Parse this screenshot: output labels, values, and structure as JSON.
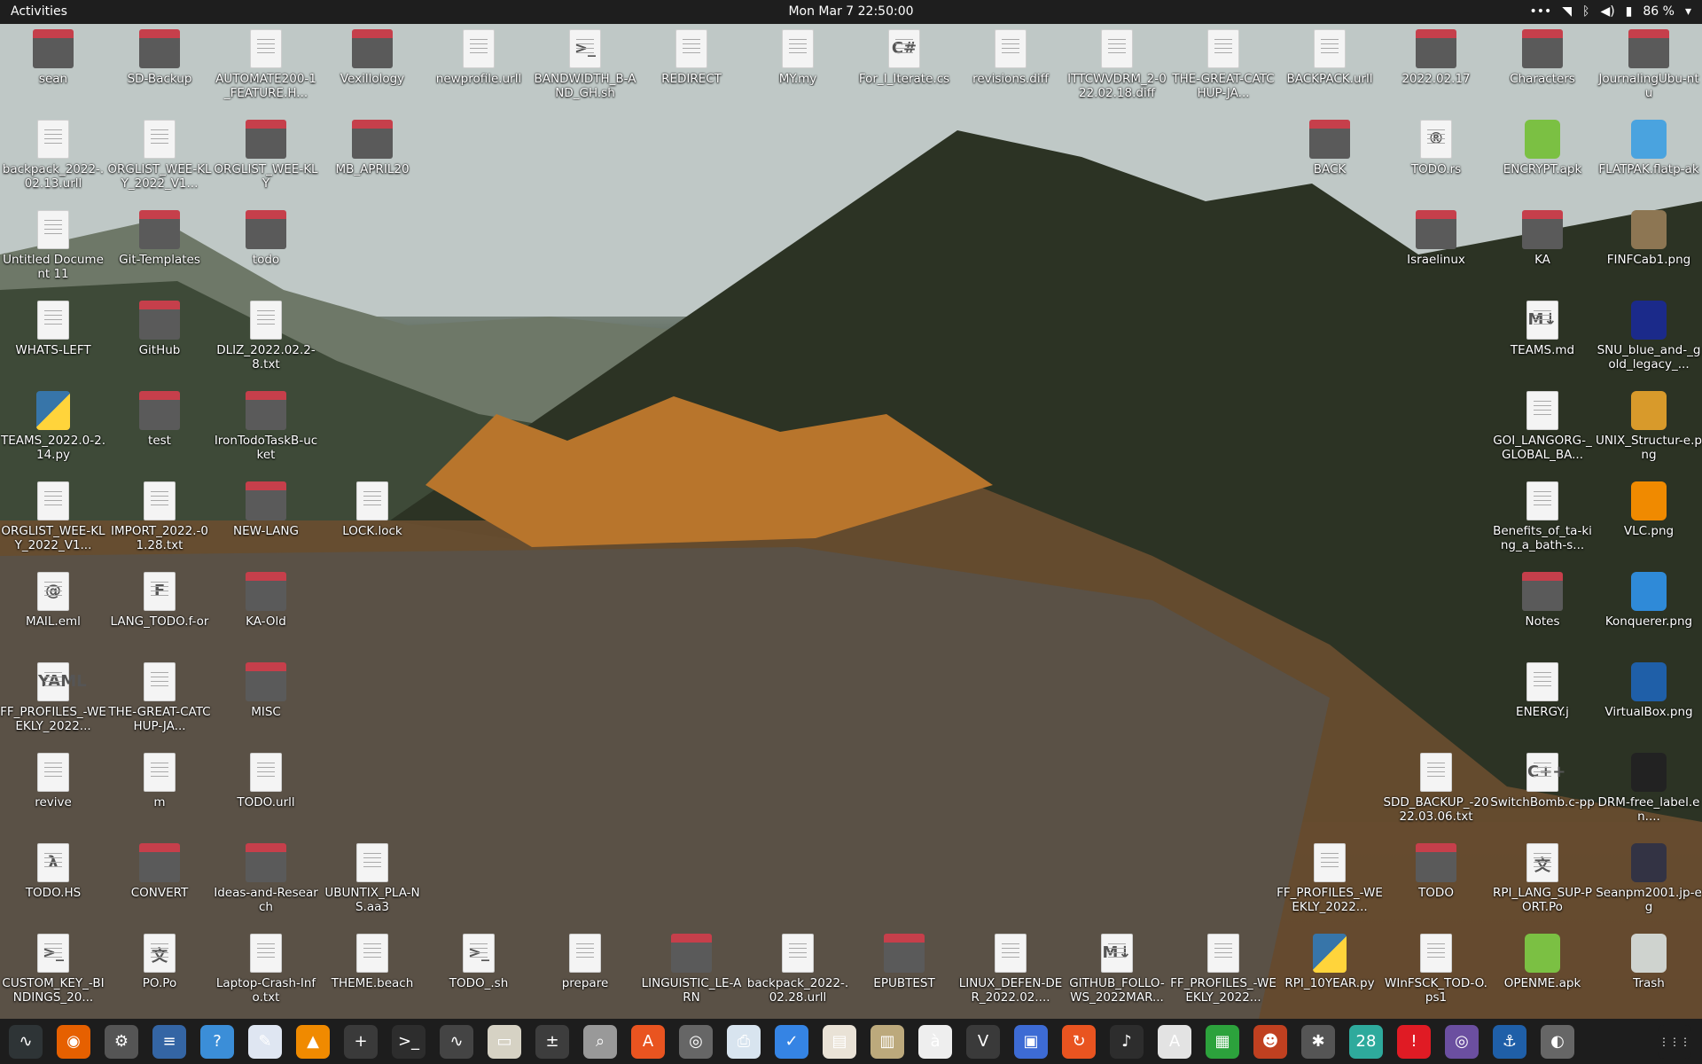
{
  "topbar": {
    "activities": "Activities",
    "clock": "Mon Mar 7  22:50:00",
    "battery": "86 %",
    "icons": [
      "dots-icon",
      "wifi-icon",
      "bluetooth-icon",
      "volume-icon",
      "battery-icon"
    ]
  },
  "desktop_icons": [
    {
      "label": "sean",
      "kind": "folder",
      "col": 0,
      "row": 0
    },
    {
      "label": "SD-Backup",
      "kind": "folder",
      "col": 1,
      "row": 0
    },
    {
      "label": "AUTOMATE200-1_FEATURE.H...",
      "kind": "doc",
      "col": 2,
      "row": 0
    },
    {
      "label": "Vexillology",
      "kind": "folder",
      "col": 3,
      "row": 0
    },
    {
      "label": "newprofile.urll",
      "kind": "doc",
      "col": 4,
      "row": 0
    },
    {
      "label": "BANDWIDTH_B-AND_GH.sh",
      "kind": "doc",
      "sym": ">_",
      "col": 5,
      "row": 0
    },
    {
      "label": "REDIRECT",
      "kind": "doc",
      "col": 6,
      "row": 0
    },
    {
      "label": "MY.my",
      "kind": "doc",
      "col": 7,
      "row": 0
    },
    {
      "label": "For_I_Iterate.cs",
      "kind": "doc",
      "sym": "C#",
      "col": 8,
      "row": 0
    },
    {
      "label": "revisions.diff",
      "kind": "doc",
      "col": 9,
      "row": 0
    },
    {
      "label": "ITTCWVDRM_2-022.02.18.diff",
      "kind": "doc",
      "col": 10,
      "row": 0
    },
    {
      "label": "THE-GREAT-CATCHUP-JA...",
      "kind": "doc",
      "col": 11,
      "row": 0
    },
    {
      "label": "BACKPACK.urll",
      "kind": "doc",
      "col": 12,
      "row": 0
    },
    {
      "label": "2022.02.17",
      "kind": "folder",
      "col": 13,
      "row": 0
    },
    {
      "label": "Characters",
      "kind": "folder",
      "col": 14,
      "row": 0
    },
    {
      "label": "JournalingUbu-ntu",
      "kind": "folder",
      "col": 15,
      "row": 0
    },
    {
      "label": "backpack_2022-.02.13.urll",
      "kind": "doc",
      "col": 0,
      "row": 1
    },
    {
      "label": "ORGLIST_WEE-KLY_2022_V1...",
      "kind": "doc",
      "col": 1,
      "row": 1
    },
    {
      "label": "ORGLIST_WEE-KLY",
      "kind": "folder",
      "col": 2,
      "row": 1
    },
    {
      "label": "MB_APRIL20",
      "kind": "folder",
      "col": 3,
      "row": 1
    },
    {
      "label": "BACK",
      "kind": "folder",
      "col": 12,
      "row": 1
    },
    {
      "label": "TODO.rs",
      "kind": "doc",
      "sym": "®",
      "col": 13,
      "row": 1
    },
    {
      "label": "ENCRYPT.apk",
      "kind": "app",
      "color": "#7bc043",
      "col": 14,
      "row": 1
    },
    {
      "label": "FLATPAK.flatp-ak",
      "kind": "app",
      "color": "#4aa3df",
      "col": 15,
      "row": 1
    },
    {
      "label": "Untitled Document 11",
      "kind": "doc",
      "col": 0,
      "row": 2
    },
    {
      "label": "Git-Templates",
      "kind": "folder",
      "col": 1,
      "row": 2
    },
    {
      "label": "todo",
      "kind": "folder",
      "col": 2,
      "row": 2
    },
    {
      "label": "Israelinux",
      "kind": "folder",
      "col": 13,
      "row": 2
    },
    {
      "label": "KA",
      "kind": "folder",
      "col": 14,
      "row": 2
    },
    {
      "label": "FINFCab1.png",
      "kind": "app",
      "color": "#8d7653",
      "col": 15,
      "row": 2
    },
    {
      "label": "WHATS-LEFT",
      "kind": "doc",
      "col": 0,
      "row": 3
    },
    {
      "label": "GitHub",
      "kind": "folder",
      "col": 1,
      "row": 3
    },
    {
      "label": "DLIZ_2022.02.2-8.txt",
      "kind": "doc",
      "col": 2,
      "row": 3
    },
    {
      "label": "TEAMS.md",
      "kind": "doc",
      "sym": "M↓",
      "col": 14,
      "row": 3
    },
    {
      "label": "SNU_blue_and-_gold_legacy_...",
      "kind": "app",
      "color": "#1b2a8a",
      "col": 15,
      "row": 3
    },
    {
      "label": "TEAMS_2022.0-2.14.py",
      "kind": "py",
      "col": 0,
      "row": 4
    },
    {
      "label": "test",
      "kind": "folder",
      "col": 1,
      "row": 4
    },
    {
      "label": "IronTodoTaskB-ucket",
      "kind": "folder",
      "col": 2,
      "row": 4
    },
    {
      "label": "GOI_LANGORG-_GLOBAL_BA...",
      "kind": "doc",
      "col": 14,
      "row": 4
    },
    {
      "label": "UNIX_Structur-e.png",
      "kind": "app",
      "color": "#d89a2b",
      "col": 15,
      "row": 4
    },
    {
      "label": "ORGLIST_WEE-KLY_2022_V1...",
      "kind": "doc",
      "col": 0,
      "row": 5
    },
    {
      "label": "IMPORT_2022.-01.28.txt",
      "kind": "doc",
      "col": 1,
      "row": 5
    },
    {
      "label": "NEW-LANG",
      "kind": "folder",
      "col": 2,
      "row": 5
    },
    {
      "label": "LOCK.lock",
      "kind": "doc",
      "col": 3,
      "row": 5
    },
    {
      "label": "Benefits_of_ta-king_a_bath-s...",
      "kind": "doc",
      "col": 14,
      "row": 5
    },
    {
      "label": "VLC.png",
      "kind": "app",
      "color": "#f08a00",
      "col": 15,
      "row": 5
    },
    {
      "label": "MAIL.eml",
      "kind": "doc",
      "sym": "@",
      "col": 0,
      "row": 6
    },
    {
      "label": "LANG_TODO.f-or",
      "kind": "doc",
      "sym": "F",
      "col": 1,
      "row": 6
    },
    {
      "label": "KA-Old",
      "kind": "folder",
      "col": 2,
      "row": 6
    },
    {
      "label": "Notes",
      "kind": "folder",
      "col": 14,
      "row": 6
    },
    {
      "label": "Konquerer.png",
      "kind": "app",
      "color": "#2f8ad8",
      "col": 15,
      "row": 6
    },
    {
      "label": "FF_PROFILES_-WEEKLY_2022...",
      "kind": "doc",
      "sym": "YAML",
      "col": 0,
      "row": 7
    },
    {
      "label": "THE-GREAT-CATCHUP-JA...",
      "kind": "doc",
      "col": 1,
      "row": 7
    },
    {
      "label": "MISC",
      "kind": "folder",
      "col": 2,
      "row": 7
    },
    {
      "label": "ENERGY.j",
      "kind": "doc",
      "col": 14,
      "row": 7
    },
    {
      "label": "VirtualBox.png",
      "kind": "app",
      "color": "#1f5fa8",
      "col": 15,
      "row": 7
    },
    {
      "label": "revive",
      "kind": "doc",
      "col": 0,
      "row": 8
    },
    {
      "label": "m",
      "kind": "doc",
      "col": 1,
      "row": 8
    },
    {
      "label": "TODO.urll",
      "kind": "doc",
      "col": 2,
      "row": 8
    },
    {
      "label": "SDD_BACKUP_-2022.03.06.txt",
      "kind": "doc",
      "col": 13,
      "row": 8
    },
    {
      "label": "SwitchBomb.c-pp",
      "kind": "doc",
      "sym": "C++",
      "col": 14,
      "row": 8
    },
    {
      "label": "DRM-free_label.en....",
      "kind": "app",
      "color": "#222",
      "col": 15,
      "row": 8
    },
    {
      "label": "TODO.HS",
      "kind": "doc",
      "sym": "λ",
      "col": 0,
      "row": 9
    },
    {
      "label": "CONVERT",
      "kind": "folder",
      "col": 1,
      "row": 9
    },
    {
      "label": "Ideas-and-Research",
      "kind": "folder",
      "col": 2,
      "row": 9
    },
    {
      "label": "UBUNTIX_PLA-NS.aa3",
      "kind": "doc",
      "col": 3,
      "row": 9
    },
    {
      "label": "FF_PROFILES_-WEEKLY_2022...",
      "kind": "doc",
      "col": 12,
      "row": 9
    },
    {
      "label": "TODO",
      "kind": "folder",
      "col": 13,
      "row": 9
    },
    {
      "label": "RPI_LANG_SUP-PORT.Po",
      "kind": "doc",
      "sym": "文",
      "col": 14,
      "row": 9
    },
    {
      "label": "Seanpm2001.jp-eg",
      "kind": "app",
      "color": "#334",
      "col": 15,
      "row": 9
    },
    {
      "label": "CUSTOM_KEY_-BINDINGS_20...",
      "kind": "doc",
      "sym": ">_",
      "col": 0,
      "row": 10
    },
    {
      "label": "PO.Po",
      "kind": "doc",
      "sym": "文",
      "col": 1,
      "row": 10
    },
    {
      "label": "Laptop-Crash-Info.txt",
      "kind": "doc",
      "col": 2,
      "row": 10
    },
    {
      "label": "THEME.beach",
      "kind": "doc",
      "col": 3,
      "row": 10
    },
    {
      "label": "TODO_.sh",
      "kind": "doc",
      "sym": ">_",
      "col": 4,
      "row": 10
    },
    {
      "label": "prepare",
      "kind": "doc",
      "col": 5,
      "row": 10
    },
    {
      "label": "LINGUISTIC_LE-ARN",
      "kind": "folder",
      "col": 6,
      "row": 10
    },
    {
      "label": "backpack_2022-.02.28.urll",
      "kind": "doc",
      "col": 7,
      "row": 10
    },
    {
      "label": "EPUBTEST",
      "kind": "folder",
      "col": 8,
      "row": 10
    },
    {
      "label": "LINUX_DEFEN-DER_2022.02....",
      "kind": "doc",
      "col": 9,
      "row": 10
    },
    {
      "label": "GITHUB_FOLLO-WS_2022MAR...",
      "kind": "doc",
      "sym": "M↓",
      "col": 10,
      "row": 10
    },
    {
      "label": "FF_PROFILES_-WEEKLY_2022...",
      "kind": "doc",
      "col": 11,
      "row": 10
    },
    {
      "label": "RPI_10YEAR.py",
      "kind": "py",
      "col": 12,
      "row": 10
    },
    {
      "label": "WInFSCK_TOD-O.ps1",
      "kind": "doc",
      "col": 13,
      "row": 10
    },
    {
      "label": "OPENME.apk",
      "kind": "app",
      "color": "#7bc043",
      "col": 14,
      "row": 10
    },
    {
      "label": "Trash",
      "kind": "app",
      "color": "#cfd3cf",
      "col": 15,
      "row": 10
    }
  ],
  "dock": [
    {
      "name": "system-monitor-icon",
      "sym": "∿",
      "color": "#2e3436"
    },
    {
      "name": "firefox-icon",
      "sym": "◉",
      "color": "#e66000"
    },
    {
      "name": "settings-icon",
      "sym": "⚙",
      "color": "#555"
    },
    {
      "name": "text-editor-icon",
      "sym": "≡",
      "color": "#3465a4"
    },
    {
      "name": "help-icon",
      "sym": "?",
      "color": "#3b8ed8"
    },
    {
      "name": "notes-icon",
      "sym": "✎",
      "color": "#dfe6f2"
    },
    {
      "name": "vlc-icon",
      "sym": "▲",
      "color": "#f08a00"
    },
    {
      "name": "app-icon",
      "sym": "+",
      "color": "#3a3a3a"
    },
    {
      "name": "terminal-icon",
      "sym": ">_",
      "color": "#2d2d2d"
    },
    {
      "name": "monitor-icon",
      "sym": "∿",
      "color": "#444"
    },
    {
      "name": "files-icon",
      "sym": "▭",
      "color": "#d6d2c4"
    },
    {
      "name": "calculator-icon",
      "sym": "±",
      "color": "#3d3d3d"
    },
    {
      "name": "image-viewer-icon",
      "sym": "⌕",
      "color": "#999"
    },
    {
      "name": "software-icon",
      "sym": "A",
      "color": "#e95420"
    },
    {
      "name": "disk-icon",
      "sym": "◎",
      "color": "#666"
    },
    {
      "name": "scanner-icon",
      "sym": "⎙",
      "color": "#d8e4ef"
    },
    {
      "name": "todo-icon",
      "sym": "✓",
      "color": "#3584e4"
    },
    {
      "name": "document-viewer-icon",
      "sym": "▤",
      "color": "#e9e2d6"
    },
    {
      "name": "archive-icon",
      "sym": "▥",
      "color": "#bca97c"
    },
    {
      "name": "character-map-icon",
      "sym": "à",
      "color": "#eee"
    },
    {
      "name": "vim-icon",
      "sym": "V",
      "color": "#3a3a3a"
    },
    {
      "name": "screen-icon",
      "sym": "▣",
      "color": "#3d6bd4"
    },
    {
      "name": "update-icon",
      "sym": "↻",
      "color": "#e95420"
    },
    {
      "name": "music-icon",
      "sym": "♪",
      "color": "#2d2d2d"
    },
    {
      "name": "font-icon",
      "sym": "A",
      "color": "#e3e3e3"
    },
    {
      "name": "spreadsheet-icon",
      "sym": "▦",
      "color": "#2ca23c"
    },
    {
      "name": "game-icon",
      "sym": "☻",
      "color": "#c04020"
    },
    {
      "name": "bug-icon",
      "sym": "✱",
      "color": "#555"
    },
    {
      "name": "calendar-icon",
      "sym": "28",
      "color": "#2eaa9c"
    },
    {
      "name": "alert-icon",
      "sym": "!",
      "color": "#e01b24"
    },
    {
      "name": "screenshot-icon",
      "sym": "◎",
      "color": "#6b4fa0"
    },
    {
      "name": "chart-icon",
      "sym": "⚓",
      "color": "#1f5fa8"
    },
    {
      "name": "privacy-icon",
      "sym": "◐",
      "color": "#666"
    },
    {
      "name": "app-grid-icon",
      "sym": "⋮⋮⋮",
      "color": "#1d1d1d"
    }
  ]
}
